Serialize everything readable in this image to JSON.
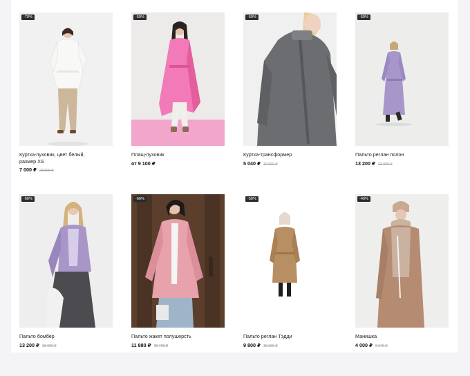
{
  "products": [
    {
      "badge": "-70%",
      "title": "Куртка-пуховик, цвет белый, размер XS",
      "price": "7 000 ₽",
      "old_price": "23 500 ₽",
      "colors": {
        "bg": "#f1f1f1",
        "floor": "#ebebeb",
        "coat": "#f8f8f6",
        "pants": "#cdb79a",
        "hair": "#3b2d25",
        "skin": "#e8c7b2",
        "shoes": "#6b4a35"
      }
    },
    {
      "badge": "-50%",
      "title": "Плащ-пуховик",
      "price": "от 9 100 ₽",
      "old_price": "",
      "colors": {
        "bg": "#ecebea",
        "floor": "#f2a6cc",
        "coat": "#f37ab8",
        "pants": "#f1efec",
        "hair": "#2a2320",
        "skin": "#e8c7b2",
        "shoes": "#8c6a58"
      }
    },
    {
      "badge": "-60%",
      "title": "Куртка-трансформер",
      "price": "5 040 ₽",
      "old_price": "12 600 ₽",
      "colors": {
        "bg": "#f0f0f0",
        "floor": "#f0f0f0",
        "coat": "#6b6d70",
        "pants": "#6b6d70",
        "hair": "#e7cf9a",
        "skin": "#efd2bf",
        "shoes": "#6b6d70"
      }
    },
    {
      "badge": "-60%",
      "title": "Пальто реглан полон",
      "price": "13 200 ₽",
      "old_price": "33 000 ₽",
      "colors": {
        "bg": "#ededec",
        "floor": "#e6e6e5",
        "coat": "#a796c9",
        "pants": "#d9d3e3",
        "hair": "#c9a77a",
        "skin": "#e8c7b2",
        "shoes": "#2a2a2a"
      }
    },
    {
      "badge": "-60%",
      "title": "Пальто бомбер",
      "price": "13 200 ₽",
      "old_price": "33 000 ₽",
      "colors": {
        "bg": "#eeeeee",
        "floor": "#eeeeee",
        "coat": "#a896c8",
        "pants": "#4c4c50",
        "hair": "#d4b27c",
        "skin": "#e8c7b2",
        "shoes": "#2a2a2a"
      }
    },
    {
      "badge": "-60%",
      "title": "Пальто жакет полушерсть",
      "price": "11 880 ₽",
      "old_price": "29 700 ₽",
      "colors": {
        "bg": "#5b3f2c",
        "floor": "#4a3324",
        "coat": "#e7a2ac",
        "pants": "#9fb3c9",
        "hair": "#1f1a17",
        "skin": "#e5c2ad",
        "shoes": "#e9e9e9"
      }
    },
    {
      "badge": "-50%",
      "title": "Пальто реглан Тэдди",
      "price": "9 800 ₽",
      "old_price": "19 600 ₽",
      "colors": {
        "bg": "#ffffff",
        "floor": "#ffffff",
        "coat": "#b88f62",
        "pants": "#2a2a2a",
        "hair": "#e4d8cf",
        "skin": "#e8c7b2",
        "shoes": "#1e1e1e"
      }
    },
    {
      "badge": "-40%",
      "title": "Манишка",
      "price": "4 000 ₽",
      "old_price": "6 670 ₽",
      "colors": {
        "bg": "#eeeeec",
        "floor": "#eeeeec",
        "coat": "#b58c72",
        "pants": "#b58c72",
        "hair": "#c7a994",
        "skin": "#e8c7b2",
        "shoes": "#b58c72"
      }
    }
  ]
}
